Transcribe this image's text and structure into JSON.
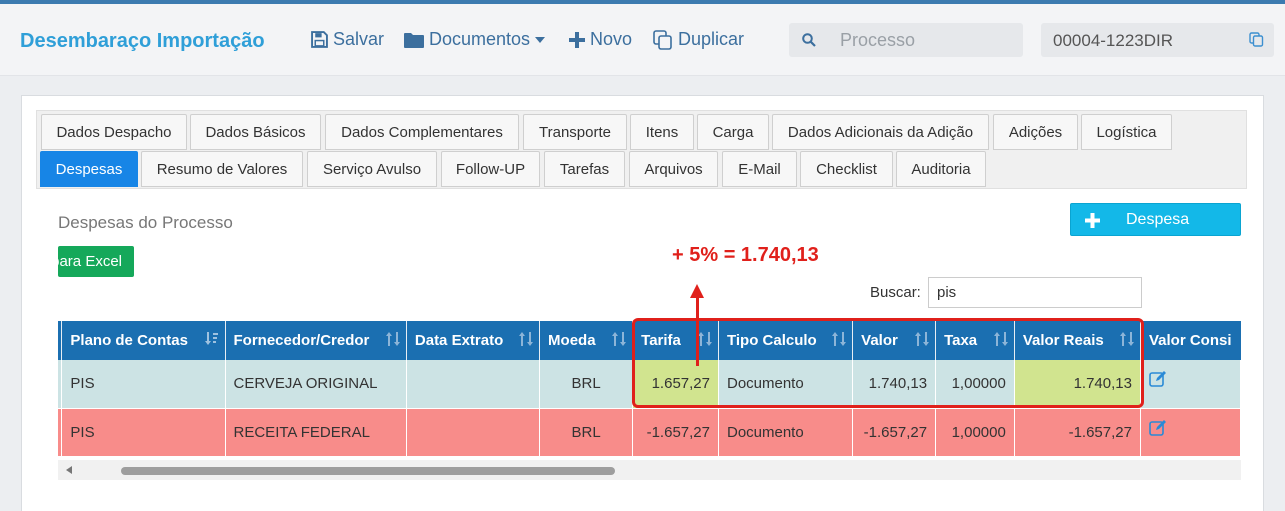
{
  "app": {
    "title": "Desembaraço Importação"
  },
  "toolbar": {
    "save_label": "Salvar",
    "documents_label": "Documentos",
    "new_label": "Novo",
    "duplicate_label": "Duplicar"
  },
  "search": {
    "placeholder": "Processo",
    "value": ""
  },
  "process": {
    "number": "00004-1223DIR"
  },
  "tabs_row1": [
    "Dados Despacho",
    "Dados Básicos",
    "Dados Complementares",
    "Transporte",
    "Itens",
    "Carga",
    "Dados Adicionais da Adição",
    "Adições",
    "Logística"
  ],
  "tabs_row2": [
    "Despesas",
    "Resumo de Valores",
    "Serviço Avulso",
    "Follow-UP",
    "Tarefas",
    "Arquivos",
    "E-Mail",
    "Checklist",
    "Auditoria"
  ],
  "active_tab": "Despesas",
  "section": {
    "title": "Despesas do Processo",
    "add_button": "Despesa",
    "excel_button": "para Excel",
    "search_label": "Buscar:",
    "search_value": "pis"
  },
  "annotation": {
    "text": "+ 5% = 1.740,13",
    "color": "#e0201b"
  },
  "table": {
    "headers": [
      "Plano de Contas",
      "Fornecedor/Credor",
      "Data Extrato",
      "Moeda",
      "Tarifa",
      "Tipo Calculo",
      "Valor",
      "Taxa",
      "Valor Reais",
      "Valor Consi"
    ],
    "rows": [
      [
        "PIS",
        "CERVEJA ORIGINAL",
        "",
        "BRL",
        "1.657,27",
        "Documento",
        "1.740,13",
        "1,00000",
        "1.740,13",
        ""
      ],
      [
        "PIS",
        "RECEITA FEDERAL",
        "",
        "BRL",
        "-1.657,27",
        "Documento",
        "-1.657,27",
        "1,00000",
        "-1.657,27",
        ""
      ]
    ]
  },
  "colors": {
    "brand": "#2f9fd8",
    "header_bg": "#1b6fb1",
    "active_tab": "#1785e6",
    "row_teal": "#cce3e4",
    "row_red": "#f88c8a",
    "highlight": "#d1e48f",
    "excel_green": "#15a85a",
    "add_blue": "#13b8e8"
  }
}
